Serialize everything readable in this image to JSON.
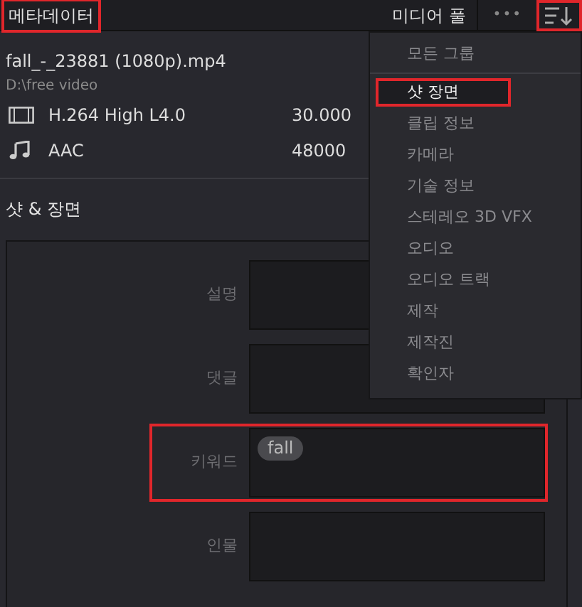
{
  "header": {
    "title": "메타데이터",
    "title_highlighted": true,
    "media_pool": "미디어 풀",
    "more": "•••",
    "sort_highlighted": true
  },
  "clip": {
    "name": "fall_-_23881 (1080p).mp4",
    "path": "D:\\free video",
    "streams": [
      {
        "kind": "video",
        "codec": "H.264 High L4.0",
        "rate": "30.000"
      },
      {
        "kind": "audio",
        "codec": "AAC",
        "rate": "48000"
      }
    ]
  },
  "section": {
    "title": "샷 & 장면"
  },
  "fields": [
    {
      "label": "설명",
      "highlighted": false
    },
    {
      "label": "댓글",
      "highlighted": false
    },
    {
      "label": "키워드",
      "highlighted": true,
      "tags": [
        "fall"
      ]
    },
    {
      "label": "인물",
      "highlighted": false
    }
  ],
  "menu": {
    "items": [
      {
        "label": "모든 그룹",
        "selected": false,
        "highlighted": false,
        "separator_after": true
      },
      {
        "label": "샷 장면",
        "selected": true,
        "highlighted": true,
        "separator_after": false
      },
      {
        "label": "클립 정보",
        "selected": false,
        "highlighted": false,
        "separator_after": false
      },
      {
        "label": "카메라",
        "selected": false,
        "highlighted": false,
        "separator_after": false
      },
      {
        "label": "기술 정보",
        "selected": false,
        "highlighted": false,
        "separator_after": false
      },
      {
        "label": "스테레오 3D VFX",
        "selected": false,
        "highlighted": false,
        "separator_after": false
      },
      {
        "label": "오디오",
        "selected": false,
        "highlighted": false,
        "separator_after": false
      },
      {
        "label": "오디오 트랙",
        "selected": false,
        "highlighted": false,
        "separator_after": false
      },
      {
        "label": "제작",
        "selected": false,
        "highlighted": false,
        "separator_after": false
      },
      {
        "label": "제작진",
        "selected": false,
        "highlighted": false,
        "separator_after": false
      },
      {
        "label": "확인자",
        "selected": false,
        "highlighted": false,
        "separator_after": false
      }
    ]
  }
}
